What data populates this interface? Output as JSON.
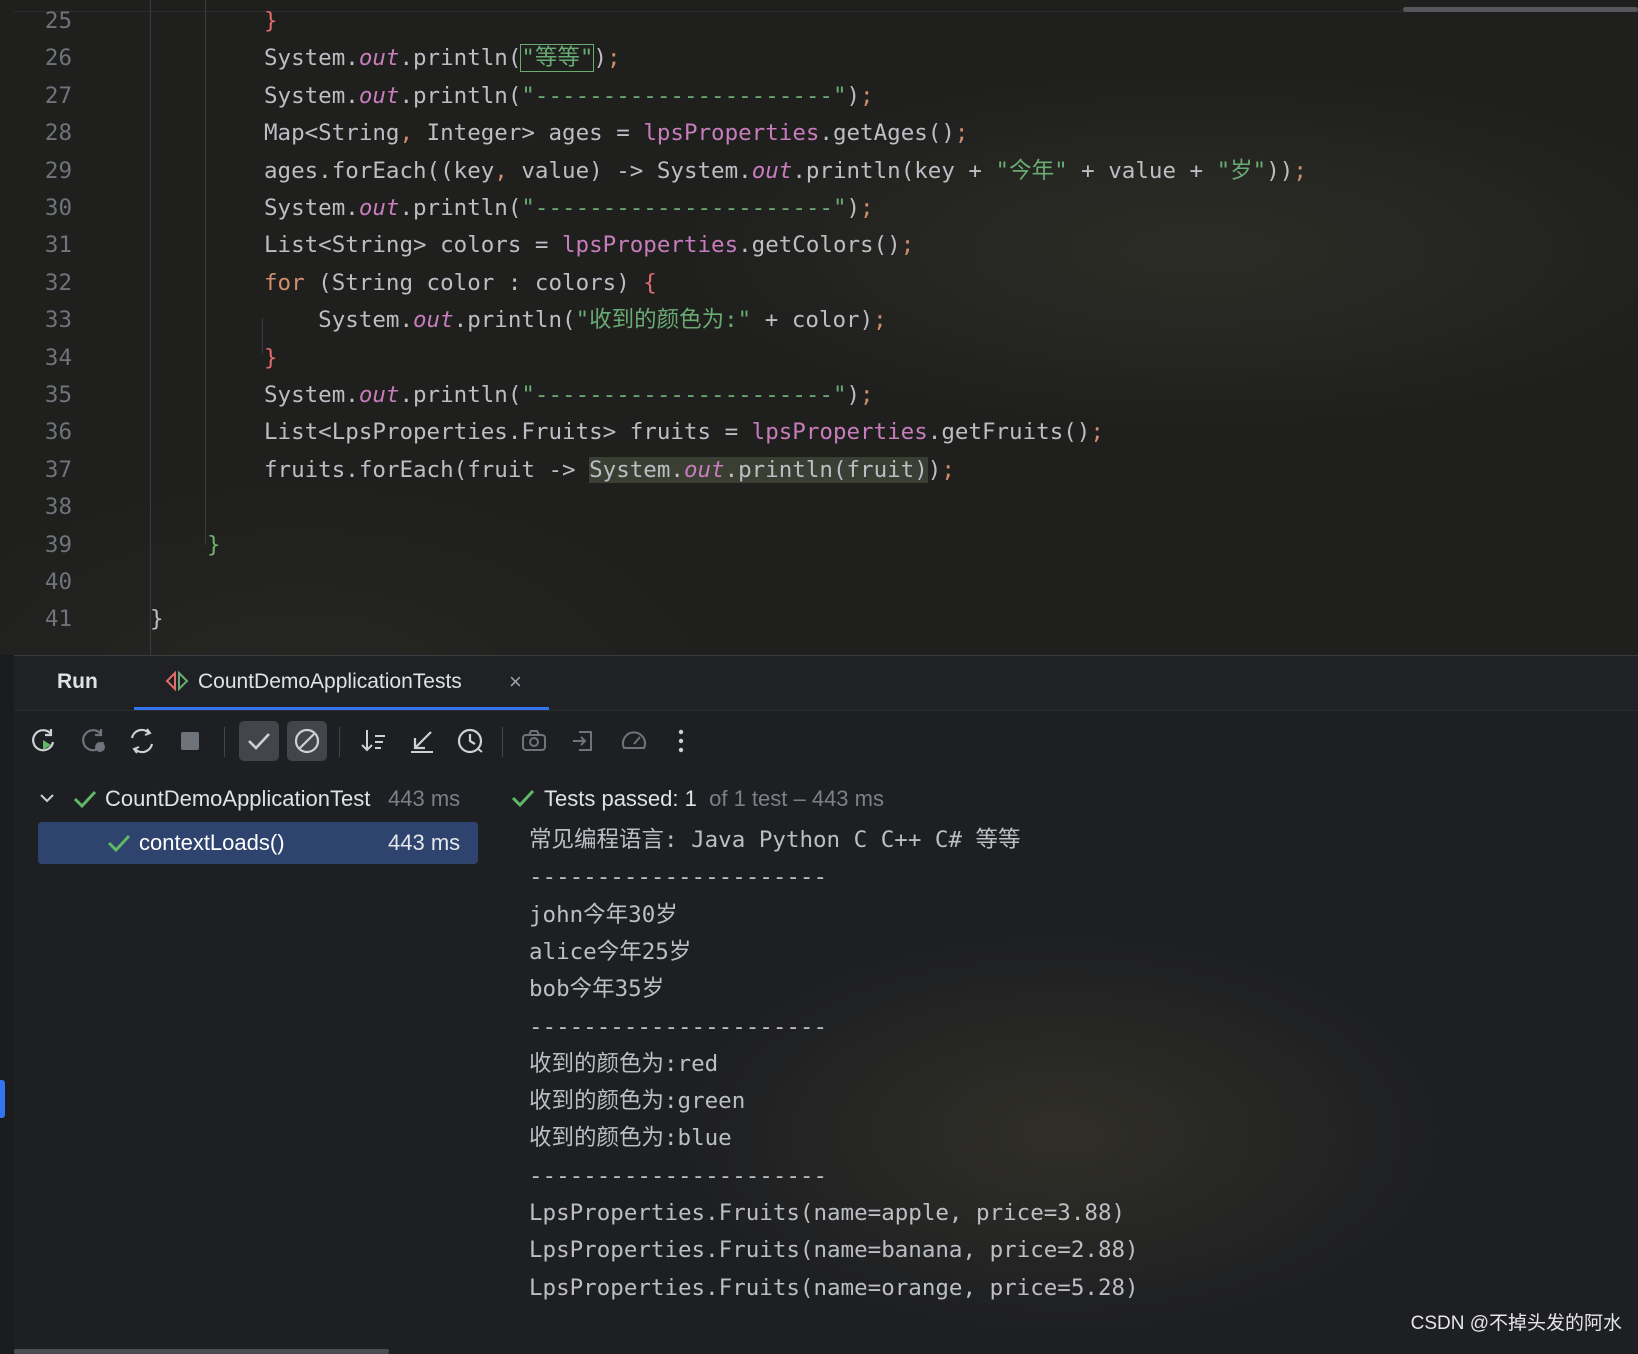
{
  "editor": {
    "lines": [
      {
        "num": "25",
        "segments": [
          {
            "t": "}",
            "c": "brR"
          }
        ]
      },
      {
        "num": "26",
        "segments": [
          {
            "t": "System.",
            "c": ""
          },
          {
            "t": "out",
            "c": "fld"
          },
          {
            "t": ".println(",
            "c": ""
          },
          {
            "t": "\"等等\"",
            "c": "st box"
          },
          {
            "t": ")",
            "c": ""
          },
          {
            "t": ";",
            "c": "kw"
          }
        ]
      },
      {
        "num": "27",
        "segments": [
          {
            "t": "System.",
            "c": ""
          },
          {
            "t": "out",
            "c": "fld"
          },
          {
            "t": ".println(",
            "c": ""
          },
          {
            "t": "\"----------------------\"",
            "c": "st"
          },
          {
            "t": ")",
            "c": ""
          },
          {
            "t": ";",
            "c": "kw"
          }
        ]
      },
      {
        "num": "28",
        "segments": [
          {
            "t": "Map<String",
            "c": ""
          },
          {
            "t": ", ",
            "c": "kw"
          },
          {
            "t": "Integer> ages = ",
            "c": ""
          },
          {
            "t": "lpsProperties",
            "c": "inst"
          },
          {
            "t": ".getAges()",
            "c": ""
          },
          {
            "t": ";",
            "c": "kw"
          }
        ]
      },
      {
        "num": "29",
        "segments": [
          {
            "t": "ages.forEach((key",
            "c": ""
          },
          {
            "t": ", ",
            "c": "kw"
          },
          {
            "t": "value) -> System.",
            "c": ""
          },
          {
            "t": "out",
            "c": "fld"
          },
          {
            "t": ".println(key + ",
            "c": ""
          },
          {
            "t": "\"今年\"",
            "c": "st"
          },
          {
            "t": " + value + ",
            "c": ""
          },
          {
            "t": "\"岁\"",
            "c": "st"
          },
          {
            "t": "))",
            "c": ""
          },
          {
            "t": ";",
            "c": "kw"
          }
        ]
      },
      {
        "num": "30",
        "segments": [
          {
            "t": "System.",
            "c": ""
          },
          {
            "t": "out",
            "c": "fld"
          },
          {
            "t": ".println(",
            "c": ""
          },
          {
            "t": "\"----------------------\"",
            "c": "st"
          },
          {
            "t": ")",
            "c": ""
          },
          {
            "t": ";",
            "c": "kw"
          }
        ]
      },
      {
        "num": "31",
        "segments": [
          {
            "t": "List<String> colors = ",
            "c": ""
          },
          {
            "t": "lpsProperties",
            "c": "inst"
          },
          {
            "t": ".getColors()",
            "c": ""
          },
          {
            "t": ";",
            "c": "kw"
          }
        ]
      },
      {
        "num": "32",
        "segments": [
          {
            "t": "for",
            "c": "kw"
          },
          {
            "t": " (String color : colors) ",
            "c": ""
          },
          {
            "t": "{",
            "c": "brR"
          }
        ]
      },
      {
        "num": "33",
        "segments": [
          {
            "t": "    System.",
            "c": ""
          },
          {
            "t": "out",
            "c": "fld"
          },
          {
            "t": ".println(",
            "c": ""
          },
          {
            "t": "\"收到的颜色为:\"",
            "c": "st"
          },
          {
            "t": " + color)",
            "c": ""
          },
          {
            "t": ";",
            "c": "kw"
          }
        ]
      },
      {
        "num": "34",
        "segments": [
          {
            "t": "}",
            "c": "brR"
          }
        ]
      },
      {
        "num": "35",
        "segments": [
          {
            "t": "System.",
            "c": ""
          },
          {
            "t": "out",
            "c": "fld"
          },
          {
            "t": ".println(",
            "c": ""
          },
          {
            "t": "\"----------------------\"",
            "c": "st"
          },
          {
            "t": ")",
            "c": ""
          },
          {
            "t": ";",
            "c": "kw"
          }
        ]
      },
      {
        "num": "36",
        "segments": [
          {
            "t": "List<LpsProperties.Fruits> fruits = ",
            "c": ""
          },
          {
            "t": "lpsProperties",
            "c": "inst"
          },
          {
            "t": ".getFruits()",
            "c": ""
          },
          {
            "t": ";",
            "c": "kw"
          }
        ]
      },
      {
        "num": "37",
        "segments": [
          {
            "t": "fruits.forEach(fruit -> ",
            "c": ""
          },
          {
            "t": "System.",
            "c": "hl"
          },
          {
            "t": "out",
            "c": "fld hl"
          },
          {
            "t": ".println(fruit)",
            "c": "hl"
          },
          {
            "t": ")",
            "c": ""
          },
          {
            "t": ";",
            "c": "kw"
          }
        ]
      },
      {
        "num": "38",
        "segments": []
      },
      {
        "num": "39",
        "segments": [
          {
            "t": "}",
            "c": "brG"
          }
        ]
      },
      {
        "num": "40",
        "segments": []
      },
      {
        "num": "41",
        "segments": [
          {
            "t": "}",
            "c": ""
          }
        ]
      }
    ]
  },
  "run_window": {
    "title": "Run",
    "tab_label": "CountDemoApplicationTests",
    "tab_close": "×",
    "toolbar": [
      {
        "name": "rerun-icon"
      },
      {
        "name": "rerun-failed-icon"
      },
      {
        "name": "toggle-auto-test-icon"
      },
      {
        "name": "stop-icon"
      },
      {
        "name": "show-passed-icon"
      },
      {
        "name": "show-ignored-icon"
      },
      {
        "name": "sort-icon"
      },
      {
        "name": "collapse-icon"
      },
      {
        "name": "history-icon"
      },
      {
        "name": "screenshot-icon"
      },
      {
        "name": "export-icon"
      },
      {
        "name": "coverage-icon"
      },
      {
        "name": "more-icon"
      }
    ]
  },
  "tree": {
    "root_label": "CountDemoApplicationTest",
    "root_time": "443 ms",
    "child_label": "contextLoads()",
    "child_time": "443 ms"
  },
  "status": {
    "passed": "Tests passed: 1",
    "rest": " of 1 test – 443 ms"
  },
  "console": [
    "常见编程语言: Java Python C C++ C# 等等",
    "----------------------",
    "john今年30岁",
    "alice今年25岁",
    "bob今年35岁",
    "----------------------",
    "收到的颜色为:red",
    "收到的颜色为:green",
    "收到的颜色为:blue",
    "----------------------",
    "LpsProperties.Fruits(name=apple, price=3.88)",
    "LpsProperties.Fruits(name=banana, price=2.88)",
    "LpsProperties.Fruits(name=orange, price=5.28)"
  ],
  "watermark": "CSDN @不掉头发的阿水",
  "colors": {
    "accent": "#3574f0",
    "pass": "#5fb865",
    "string": "#6aab73",
    "keyword": "#cf8e6d",
    "field": "#c77dbb"
  }
}
